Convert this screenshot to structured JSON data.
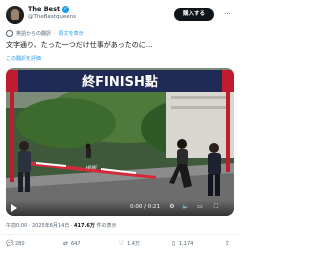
{
  "author": {
    "name": "The Best",
    "handle": "@TheBestqueens",
    "verified_badge": "✓"
  },
  "header": {
    "subscribe_label": "購入する",
    "more_glyph": "···"
  },
  "translation": {
    "note": "英語からの翻訳",
    "link": "原文を表示"
  },
  "post": {
    "text": "文字通り、たった一つだけ仕事があったのに…",
    "rate_translation": "この翻訳を評価"
  },
  "video": {
    "banner_text": "終FINISH點",
    "tape_text": "HRMF",
    "time": "0:00 / 0:21"
  },
  "meta": {
    "timestamp": "午前0:00 · 2025年6月14日 · ",
    "views": "417.6万",
    "views_suffix": " 件の表示"
  },
  "actions": {
    "replies": "280",
    "reposts": "647",
    "likes": "1.4万",
    "bookmarks": "1,174"
  }
}
